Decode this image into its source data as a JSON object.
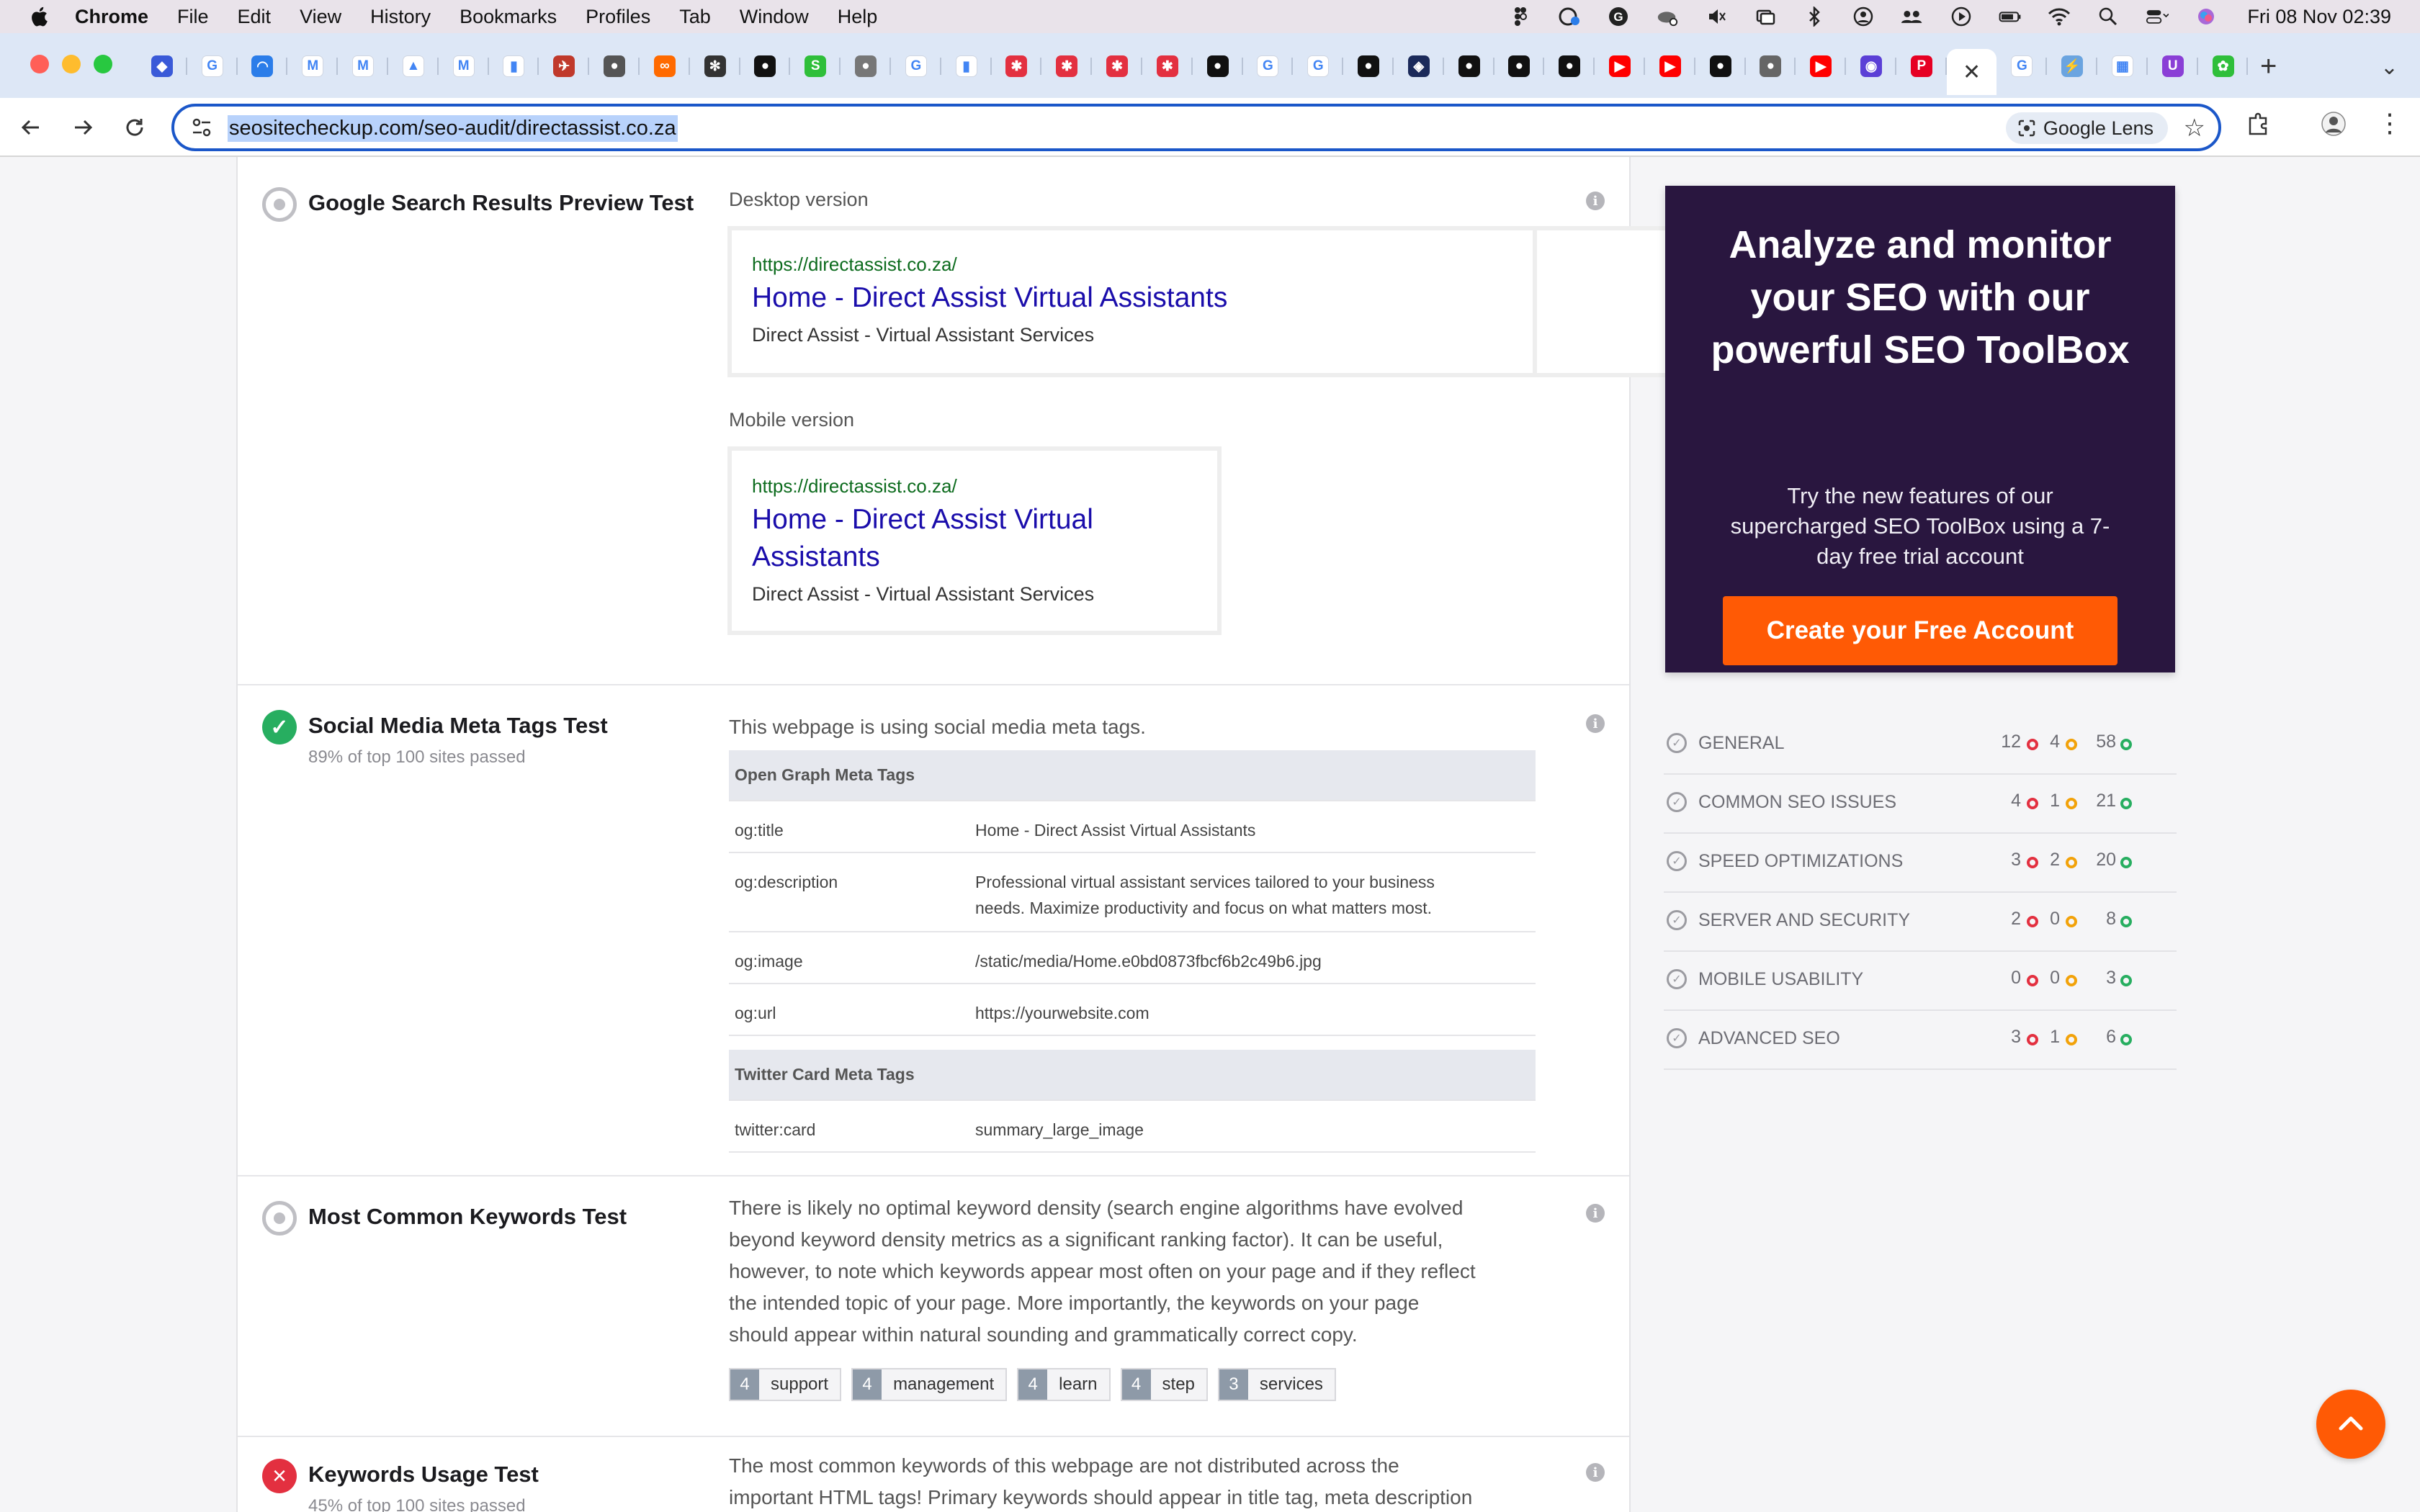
{
  "menubar": {
    "app_name": "Chrome",
    "items": [
      "File",
      "Edit",
      "View",
      "History",
      "Bookmarks",
      "Profiles",
      "Tab",
      "Window",
      "Help"
    ],
    "clock": "Fri 08 Nov  02:39"
  },
  "tabs": [
    {
      "icon": "copilot-icon",
      "color": "#3a5ad8",
      "glyph": "◆"
    },
    {
      "icon": "google-icon",
      "color": "#ffffff",
      "glyph": "G"
    },
    {
      "icon": "analytics-icon",
      "color": "#2b7de9",
      "glyph": "◠"
    },
    {
      "icon": "gmail-icon",
      "color": "#ffffff",
      "glyph": "M"
    },
    {
      "icon": "gmail-icon",
      "color": "#ffffff",
      "glyph": "M"
    },
    {
      "icon": "drive-icon",
      "color": "#ffffff",
      "glyph": "▲"
    },
    {
      "icon": "gmail-icon",
      "color": "#ffffff",
      "glyph": "M"
    },
    {
      "icon": "analytics-bars-icon",
      "color": "#ffffff",
      "glyph": "▮"
    },
    {
      "icon": "bird-icon",
      "color": "#c0392b",
      "glyph": "✈"
    },
    {
      "icon": "globe-icon",
      "color": "#555555",
      "glyph": "●"
    },
    {
      "icon": "links-icon",
      "color": "#ff6a00",
      "glyph": "∞"
    },
    {
      "icon": "openai-icon",
      "color": "#333333",
      "glyph": "✻"
    },
    {
      "icon": "github-icon",
      "color": "#111111",
      "glyph": "●"
    },
    {
      "icon": "script-icon",
      "color": "#2fbf3a",
      "glyph": "S"
    },
    {
      "icon": "globe-icon",
      "color": "#777777",
      "glyph": "●"
    },
    {
      "icon": "google-icon",
      "color": "#ffffff",
      "glyph": "G"
    },
    {
      "icon": "analytics-bars-icon",
      "color": "#ffffff",
      "glyph": "▮"
    },
    {
      "icon": "target-icon",
      "color": "#e33040",
      "glyph": "✱"
    },
    {
      "icon": "target-icon",
      "color": "#e33040",
      "glyph": "✱"
    },
    {
      "icon": "target-icon",
      "color": "#e33040",
      "glyph": "✱"
    },
    {
      "icon": "target-icon",
      "color": "#e33040",
      "glyph": "✱"
    },
    {
      "icon": "github-icon",
      "color": "#111111",
      "glyph": "●"
    },
    {
      "icon": "google-icon",
      "color": "#ffffff",
      "glyph": "G"
    },
    {
      "icon": "google-icon",
      "color": "#ffffff",
      "glyph": "G"
    },
    {
      "icon": "github-icon",
      "color": "#111111",
      "glyph": "●"
    },
    {
      "icon": "app-icon",
      "color": "#1b2a5a",
      "glyph": "◈"
    },
    {
      "icon": "github-icon",
      "color": "#111111",
      "glyph": "●"
    },
    {
      "icon": "github-icon",
      "color": "#111111",
      "glyph": "●"
    },
    {
      "icon": "github-icon",
      "color": "#111111",
      "glyph": "●"
    },
    {
      "icon": "youtube-icon",
      "color": "#ff0000",
      "glyph": "▶"
    },
    {
      "icon": "youtube-icon",
      "color": "#ff0000",
      "glyph": "▶"
    },
    {
      "icon": "github-icon",
      "color": "#111111",
      "glyph": "●"
    },
    {
      "icon": "globe-icon",
      "color": "#666666",
      "glyph": "●"
    },
    {
      "icon": "youtube-icon",
      "color": "#ff0000",
      "glyph": "▶"
    },
    {
      "icon": "podcast-icon",
      "color": "#5b3fd6",
      "glyph": "◉"
    },
    {
      "icon": "pinterest-icon",
      "color": "#e60023",
      "glyph": "P"
    },
    {
      "icon": "close-icon",
      "color": "#ffffff",
      "glyph": "✕",
      "active": true
    },
    {
      "icon": "google-icon",
      "color": "#ffffff",
      "glyph": "G"
    },
    {
      "icon": "bolt-icon",
      "color": "#6aa4e0",
      "glyph": "⚡"
    },
    {
      "icon": "grid-icon",
      "color": "#ffffff",
      "glyph": "▦"
    },
    {
      "icon": "shield-icon",
      "color": "#8a3fd6",
      "glyph": "U"
    },
    {
      "icon": "plant-icon",
      "color": "#2fbf3a",
      "glyph": "✿"
    }
  ],
  "toolbar": {
    "url": "seositecheckup.com/seo-audit/directassist.co.za",
    "lens_label": "Google Lens"
  },
  "tests": {
    "serp": {
      "title": "Google Search Results Preview Test",
      "desktop_label": "Desktop version",
      "mobile_label": "Mobile version",
      "url": "https://directassist.co.za/",
      "page_title": "Home - Direct Assist Virtual Assistants",
      "mobile_title_line1": "Home - Direct Assist Virtual",
      "mobile_title_line2": "Assistants",
      "description": "Direct Assist - Virtual Assistant Services"
    },
    "social": {
      "title": "Social Media Meta Tags Test",
      "subtitle": "89% of top 100 sites passed",
      "summary": "This webpage is using social media meta tags.",
      "og_header": "Open Graph Meta Tags",
      "og_rows": [
        {
          "key": "og:title",
          "value": "Home - Direct Assist Virtual Assistants"
        },
        {
          "key": "og:description",
          "value_line1": "Professional virtual assistant services tailored to your business",
          "value_line2": "needs. Maximize productivity and focus on what matters most."
        },
        {
          "key": "og:image",
          "value": "/static/media/Home.e0bd0873fbcf6b2c49b6.jpg"
        },
        {
          "key": "og:url",
          "value": "https://yourwebsite.com"
        }
      ],
      "twitter_header": "Twitter Card Meta Tags",
      "twitter_rows": [
        {
          "key": "twitter:card",
          "value": "summary_large_image"
        }
      ]
    },
    "keywords": {
      "title": "Most Common Keywords Test",
      "para_lines": [
        "There is likely no optimal keyword density (search engine algorithms have evolved",
        "beyond keyword density metrics as a significant ranking factor). It can be useful,",
        "however, to note which keywords appear most often on your page and if they reflect",
        "the intended topic of your page. More importantly, the keywords on your page",
        "should appear within natural sounding and grammatically correct copy."
      ],
      "items": [
        {
          "count": "4",
          "word": "support"
        },
        {
          "count": "4",
          "word": "management"
        },
        {
          "count": "4",
          "word": "learn"
        },
        {
          "count": "4",
          "word": "step"
        },
        {
          "count": "3",
          "word": "services"
        }
      ]
    },
    "usage": {
      "title": "Keywords Usage Test",
      "subtitle": "45% of top 100 sites passed",
      "para_line1": "The most common keywords of this webpage are not distributed across the",
      "para_line2": "important HTML tags! Primary keywords should appear in title tag, meta description"
    }
  },
  "promo": {
    "heading": "Analyze and monitor your SEO with our powerful SEO ToolBox",
    "body": "Try the new features of our supercharged SEO ToolBox using a 7-day free trial account",
    "cta": "Create your Free Account"
  },
  "summary": [
    {
      "label": "GENERAL",
      "failed": "12",
      "warnings": "4",
      "passed": "58"
    },
    {
      "label": "COMMON SEO ISSUES",
      "failed": "4",
      "warnings": "1",
      "passed": "21"
    },
    {
      "label": "SPEED OPTIMIZATIONS",
      "failed": "3",
      "warnings": "2",
      "passed": "20"
    },
    {
      "label": "SERVER AND SECURITY",
      "failed": "2",
      "warnings": "0",
      "passed": "8"
    },
    {
      "label": "MOBILE USABILITY",
      "failed": "0",
      "warnings": "0",
      "passed": "3"
    },
    {
      "label": "ADVANCED SEO",
      "failed": "3",
      "warnings": "1",
      "passed": "6"
    }
  ],
  "colors": {
    "accent_orange": "#ff5a05",
    "promo_bg": "#29163f",
    "pass_green": "#27ae60",
    "fail_red": "#e33040",
    "warn_orange": "#f2a20a",
    "link_blue": "#1a0dab",
    "url_green": "#0c6b1d"
  }
}
